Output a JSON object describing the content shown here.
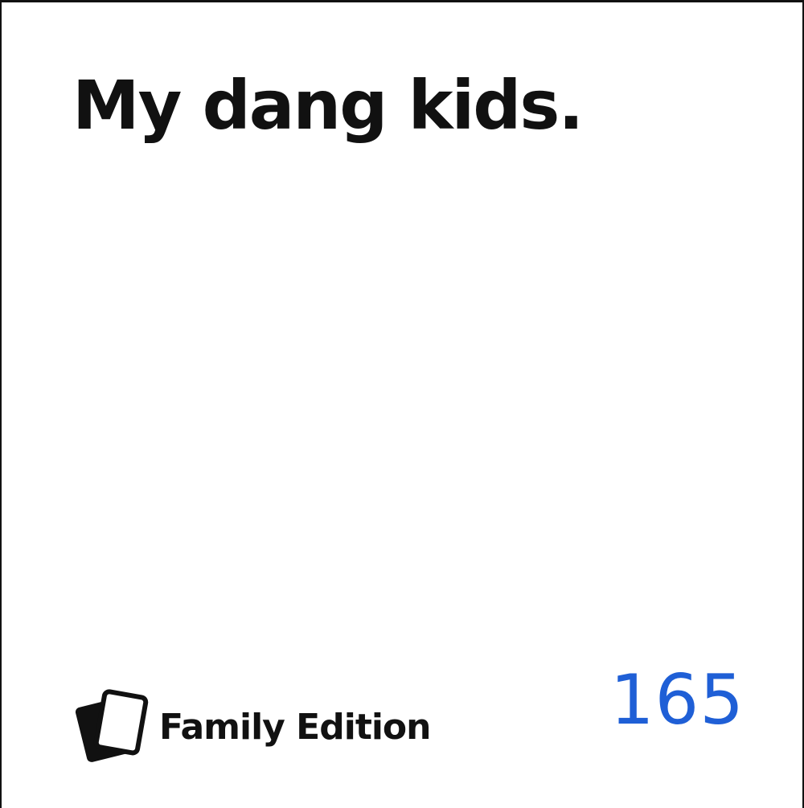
{
  "card": {
    "text": "My dang kids.",
    "background_color": "#ffffff",
    "text_color": "#111111"
  },
  "brand": {
    "logo_icon": "stacked-cards-icon",
    "label": "Family Edition"
  },
  "card_number": {
    "value": "165",
    "color": "#1f5fd6"
  }
}
